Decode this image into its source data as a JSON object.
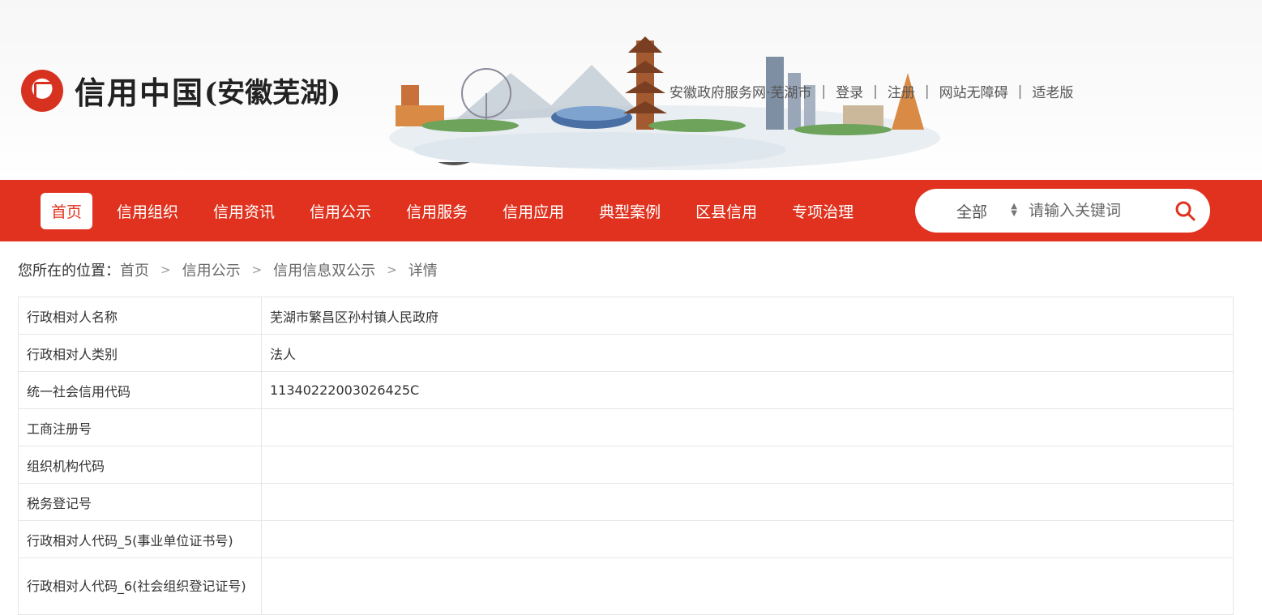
{
  "brand": {
    "title": "信用中国",
    "subtitle": "(安徽芜湖)"
  },
  "top_links": [
    {
      "label": "安徽政府服务网·芜湖市"
    },
    {
      "label": "登录"
    },
    {
      "label": "注册"
    },
    {
      "label": "网站无障碍"
    },
    {
      "label": "适老版"
    }
  ],
  "nav": {
    "items": [
      {
        "label": "首页",
        "active": true
      },
      {
        "label": "信用组织"
      },
      {
        "label": "信用资讯"
      },
      {
        "label": "信用公示"
      },
      {
        "label": "信用服务"
      },
      {
        "label": "信用应用"
      },
      {
        "label": "典型案例"
      },
      {
        "label": "区县信用"
      },
      {
        "label": "专项治理"
      }
    ]
  },
  "search": {
    "scope": "全部",
    "placeholder": "请输入关键词",
    "icon": "search-icon"
  },
  "breadcrumb": {
    "prefix": "您所在的位置：",
    "items": [
      "首页",
      "信用公示",
      "信用信息双公示",
      "详情"
    ]
  },
  "detail": {
    "rows": [
      {
        "label": "行政相对人名称",
        "value": "芜湖市繁昌区孙村镇人民政府"
      },
      {
        "label": "行政相对人类别",
        "value": "法人"
      },
      {
        "label": "统一社会信用代码",
        "value": "11340222003026425C"
      },
      {
        "label": "工商注册号",
        "value": ""
      },
      {
        "label": "组织机构代码",
        "value": ""
      },
      {
        "label": "税务登记号",
        "value": ""
      },
      {
        "label": "行政相对人代码_5(事业单位证书号)",
        "value": ""
      },
      {
        "label": "行政相对人代码_6(社会组织登记证号)",
        "value": ""
      }
    ]
  },
  "colors": {
    "accent": "#e0321e",
    "nav_text": "#ffffff",
    "border": "#e6e6e6"
  }
}
